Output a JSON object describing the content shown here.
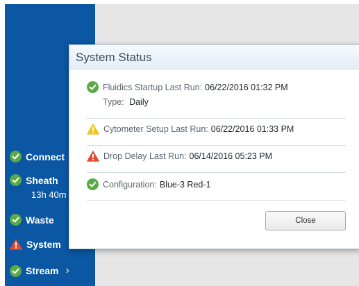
{
  "colors": {
    "sidebar_bg": "#0b57a4",
    "ok_green": "#5aab46",
    "warn_yellow": "#f2c318",
    "error_red": "#e24a2f"
  },
  "sidebar": {
    "items": [
      {
        "label": "Connect",
        "icon": "check-circle-icon"
      },
      {
        "label": "Sheath",
        "icon": "check-circle-icon",
        "sub": "13h 40m"
      },
      {
        "label": "Waste",
        "icon": "check-circle-icon"
      },
      {
        "label": "System",
        "icon": "warning-triangle-icon"
      },
      {
        "label": "Stream",
        "icon": "check-circle-icon"
      }
    ]
  },
  "dialog": {
    "title": "System Status",
    "rows": [
      {
        "key": "Fluidics Startup Last Run:",
        "value": "06/22/2016 01:32 PM",
        "icon": "check-circle-icon",
        "sub_key": "Type:",
        "sub_value": "Daily"
      },
      {
        "key": "Cytometer Setup Last Run:",
        "value": "06/22/2016 01:33 PM",
        "icon": "warning-triangle-icon"
      },
      {
        "key": "Drop Delay Last Run:",
        "value": "06/14/2016 05:23 PM",
        "icon": "warning-triangle-icon"
      },
      {
        "key": "Configuration:",
        "value": "Blue-3 Red-1",
        "icon": "check-circle-icon"
      }
    ],
    "close_label": "Close"
  }
}
